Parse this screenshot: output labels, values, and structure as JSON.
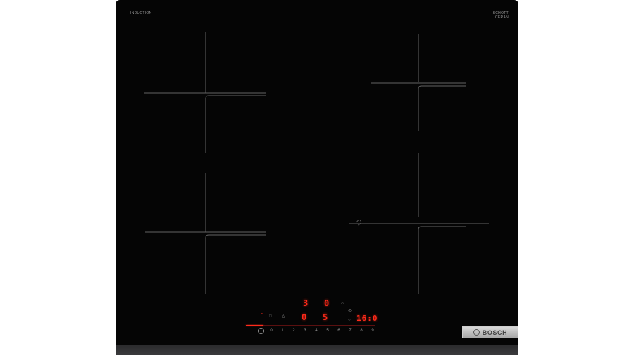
{
  "product": {
    "top_left_label": "INDUCTION",
    "top_left_sublabel": "",
    "top_right_label": "SCHOTT CERAN",
    "brand": "BOSCH"
  },
  "displays": {
    "top_left": "3",
    "top_right": "0",
    "mid_left": "0",
    "mid_right": "5",
    "timer": "16:0"
  },
  "power_scale": [
    "0",
    "1",
    "2",
    "3",
    "4",
    "5",
    "6",
    "7",
    "8",
    "9"
  ],
  "colors": {
    "glass": "#050505",
    "led": "#ff2a1a",
    "frame": "#333335",
    "badge": "#c0c0c0"
  },
  "icons": [
    "power-icon",
    "wifi-icon",
    "lock-icon",
    "pan-icon",
    "timer-icon",
    "bosch-logo-icon"
  ]
}
